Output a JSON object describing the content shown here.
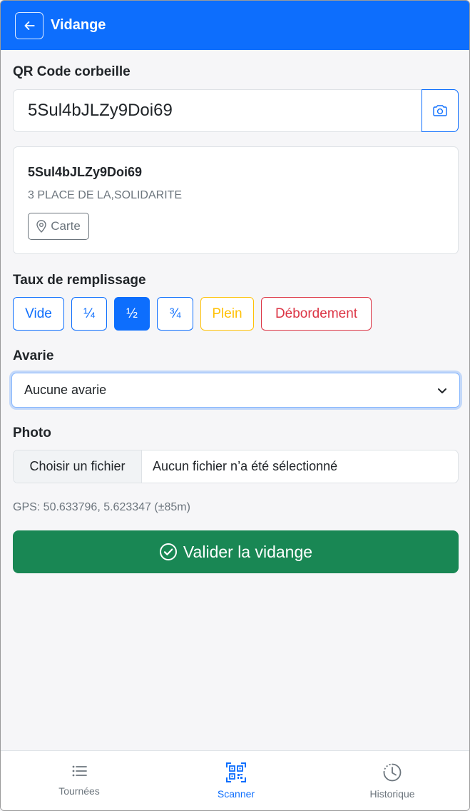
{
  "header": {
    "title": "Vidange"
  },
  "qr": {
    "label": "QR Code corbeille",
    "value": "5Sul4bJLZy9Doi69"
  },
  "bin": {
    "code": "5Sul4bJLZy9Doi69",
    "address": "3 PLACE DE LA,SOLIDARITE",
    "map_label": "Carte"
  },
  "fill": {
    "label": "Taux de remplissage",
    "options": [
      {
        "label": "Vide",
        "color": "#0d6efd"
      },
      {
        "label": "¼",
        "color": "#0d6efd"
      },
      {
        "label": "½",
        "color": "#0d6efd"
      },
      {
        "label": "¾",
        "color": "#0d6efd"
      },
      {
        "label": "Plein",
        "color": "#ffc107"
      },
      {
        "label": "Débordement",
        "color": "#dc3545"
      }
    ],
    "selected": "½"
  },
  "avarie": {
    "label": "Avarie",
    "selected": "Aucune avarie"
  },
  "photo": {
    "label": "Photo",
    "button_label": "Choisir un fichier",
    "status": "Aucun fichier n’a été sélectionné"
  },
  "gps": {
    "text": "GPS: 50.633796, 5.623347 (±85m)"
  },
  "submit": {
    "label": "Valider la vidange"
  },
  "nav": {
    "items": [
      {
        "label": "Tournées",
        "icon": "list-icon"
      },
      {
        "label": "Scanner",
        "icon": "qr-scan-icon"
      },
      {
        "label": "Historique",
        "icon": "history-icon"
      }
    ],
    "active": "Scanner"
  },
  "colors": {
    "primary": "#0d6efd",
    "success": "#198754",
    "warning": "#ffc107",
    "danger": "#dc3545"
  }
}
